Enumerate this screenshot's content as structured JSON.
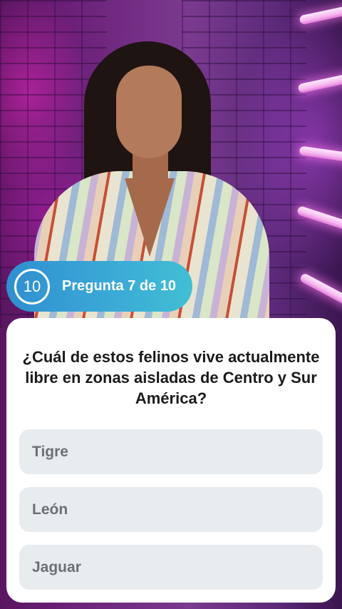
{
  "badge": {
    "timer": "10",
    "label": "Pregunta 7 de 10"
  },
  "question": {
    "text": "¿Cuál de estos felinos vive actualmente libre en zonas aisladas de Centro y Sur América?"
  },
  "options": [
    {
      "label": "Tigre"
    },
    {
      "label": "León"
    },
    {
      "label": "Jaguar"
    }
  ],
  "colors": {
    "badge_start": "#2f8fd0",
    "badge_end": "#41bfd4",
    "card_bg": "#ffffff",
    "option_bg": "#e9ecef",
    "option_text": "#6b7076",
    "question_text": "#1b1b1b"
  }
}
